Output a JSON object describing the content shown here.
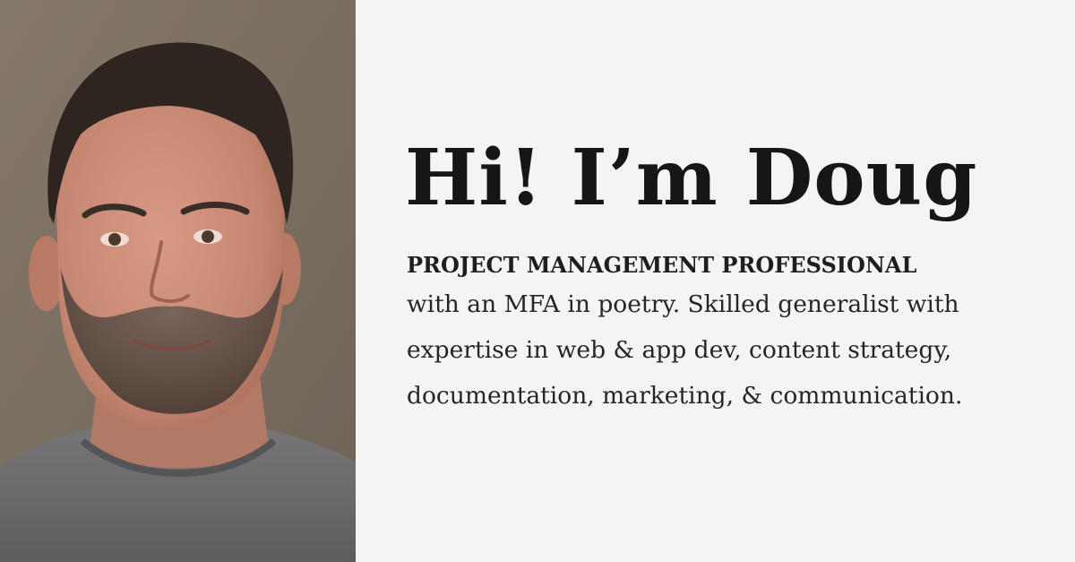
{
  "profile": {
    "photo_icon": "portrait-photo",
    "headline": "Hi! I’m Doug",
    "title": "PROJECT MANAGEMENT PROFESSIONAL",
    "bio_lines": [
      "with an MFA in poetry. Skilled generalist with",
      "expertise in web & app dev, content strategy,",
      "documentation, marketing, & communication."
    ]
  },
  "colors": {
    "background": "#f4f4f4",
    "text": "#1c1c1c",
    "photo_wall": "#7a6e62",
    "photo_shirt": "#6b6b6d"
  }
}
